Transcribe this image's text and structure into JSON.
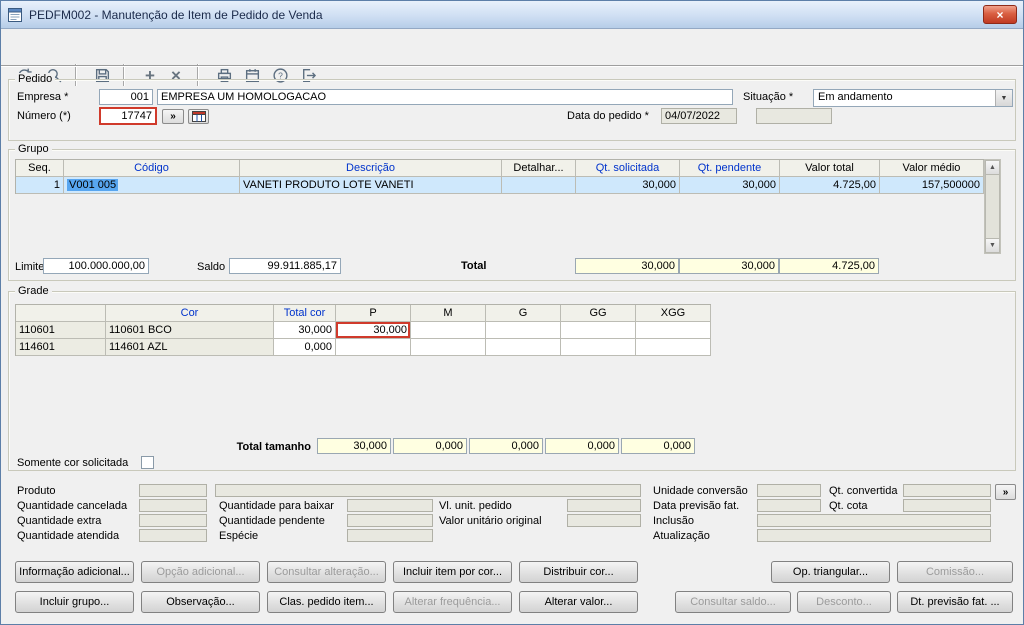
{
  "window": {
    "title": "PEDFM002 - Manutenção de Item de Pedido de Venda",
    "close_label": "×"
  },
  "toolbar": {
    "icons": [
      "undo-icon",
      "search-icon",
      "save-icon",
      "add-icon",
      "delete-icon",
      "print-icon",
      "calendar-icon",
      "help-icon",
      "exit-icon"
    ],
    "add_glyph": "+",
    "delete_glyph": "×"
  },
  "pedido": {
    "legend": "Pedido",
    "empresa_label": "Empresa *",
    "empresa_code": "001",
    "empresa_name": "EMPRESA UM HOMOLOGACAO",
    "numero_label": "Número (*)",
    "numero_value": "17747",
    "expand_button": "»",
    "situacao_label": "Situação *",
    "situacao_value": "Em andamento",
    "data_pedido_label": "Data do pedido *",
    "data_pedido_value": "04/07/2022"
  },
  "grupo": {
    "legend": "Grupo",
    "headers": [
      "Seq.",
      "Código",
      "Descrição",
      "Detalhar...",
      "Qt. solicitada",
      "Qt. pendente",
      "Valor total",
      "Valor médio"
    ],
    "row": {
      "seq": "1",
      "codigo": "V001 005",
      "descricao": "VANETI PRODUTO LOTE VANETI",
      "detalhar": "",
      "qt_solicitada": "30,000",
      "qt_pendente": "30,000",
      "valor_total": "4.725,00",
      "valor_medio": "157,500000"
    },
    "limite_label": "Limite",
    "limite_value": "100.000.000,00",
    "saldo_label": "Saldo",
    "saldo_value": "99.911.885,17",
    "total_label": "Total",
    "total_qt_solicitada": "30,000",
    "total_qt_pendente": "30,000",
    "total_valor": "4.725,00"
  },
  "grade": {
    "legend": "Grade",
    "headers": {
      "cor": "Cor",
      "total_cor": "Total cor",
      "sizes": [
        "P",
        "M",
        "G",
        "GG",
        "XGG"
      ]
    },
    "rows": [
      {
        "codigo": "110601",
        "cor": "110601 BCO",
        "total_cor": "30,000",
        "p": "30,000",
        "m": "",
        "g": "",
        "gg": "",
        "xgg": ""
      },
      {
        "codigo": "114601",
        "cor": "114601 AZL",
        "total_cor": "0,000",
        "p": "",
        "m": "",
        "g": "",
        "gg": "",
        "xgg": ""
      }
    ],
    "total_tamanho_label": "Total tamanho",
    "totals": [
      "30,000",
      "0,000",
      "0,000",
      "0,000",
      "0,000"
    ],
    "somente_cor_label": "Somente cor solicitada"
  },
  "detalhes": {
    "produto_label": "Produto",
    "qtd_cancelada_label": "Quantidade cancelada",
    "qtd_extra_label": "Quantidade extra",
    "qtd_atendida_label": "Quantidade atendida",
    "qtd_para_baixar_label": "Quantidade para baixar",
    "qtd_pendente_label": "Quantidade pendente",
    "especie_label": "Espécie",
    "vl_unit_pedido_label": "Vl. unit. pedido",
    "valor_unitario_original_label": "Valor unitário original",
    "unidade_conversao_label": "Unidade conversão",
    "data_previsao_label": "Data previsão fat.",
    "inclusao_label": "Inclusão",
    "atualizacao_label": "Atualização",
    "qt_convertida_label": "Qt. convertida",
    "qt_cota_label": "Qt. cota",
    "expand_button": "»"
  },
  "buttons": {
    "row1": [
      {
        "label": "Informação adicional...",
        "enabled": true
      },
      {
        "label": "Opção adicional...",
        "enabled": false
      },
      {
        "label": "Consultar alteração...",
        "enabled": false
      },
      {
        "label": "Incluir item por cor...",
        "enabled": true
      },
      {
        "label": "Distribuir cor...",
        "enabled": true
      },
      {
        "label": "Op. triangular...",
        "enabled": true
      },
      {
        "label": "Comissão...",
        "enabled": false
      }
    ],
    "row2": [
      {
        "label": "Incluir grupo...",
        "enabled": true
      },
      {
        "label": "Observação...",
        "enabled": true
      },
      {
        "label": "Clas. pedido item...",
        "enabled": true
      },
      {
        "label": "Alterar frequência...",
        "enabled": false
      },
      {
        "label": "Alterar valor...",
        "enabled": true
      },
      {
        "label": "Consultar saldo...",
        "enabled": false
      },
      {
        "label": "Desconto...",
        "enabled": false
      },
      {
        "label": "Dt. previsão fat. ...",
        "enabled": true
      }
    ]
  }
}
